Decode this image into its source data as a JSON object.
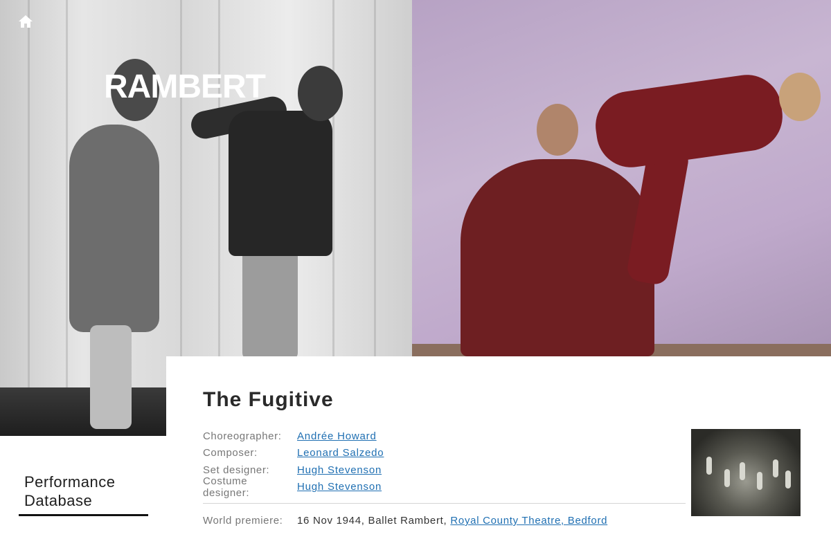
{
  "header": {
    "logo_text": "RAMBERT",
    "home_icon": "home-icon"
  },
  "sidebar": {
    "title_line1": "Performance",
    "title_line2": "Database"
  },
  "work": {
    "title": "The Fugitive",
    "credits": [
      {
        "label": "Choreographer:",
        "value": "Andrée Howard"
      },
      {
        "label": "Composer:",
        "value": "Leonard Salzedo"
      },
      {
        "label": "Set designer:",
        "value": "Hugh Stevenson"
      },
      {
        "label": "Costume designer:",
        "value": "Hugh Stevenson"
      }
    ],
    "premiere": {
      "label": "World premiere:",
      "text": "16 Nov 1944, Ballet Rambert,",
      "venue": "Royal County Theatre, Bedford"
    }
  },
  "colors": {
    "link": "#1f6fb2",
    "label": "#777777",
    "title": "#2a2a2a"
  }
}
